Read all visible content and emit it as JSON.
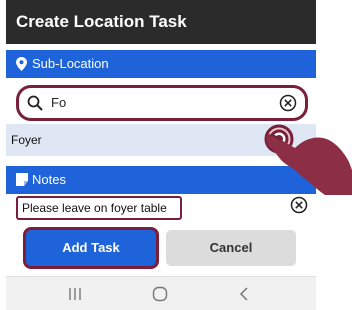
{
  "app": {
    "title": "Create Location Task"
  },
  "sub_location": {
    "header_label": "Sub-Location",
    "search_value": "Fo",
    "result_label": "Foyer"
  },
  "notes": {
    "header_label": "Notes",
    "value": "Please leave on foyer table"
  },
  "buttons": {
    "add_label": "Add Task",
    "cancel_label": "Cancel"
  },
  "icons": {
    "location": "map-pin-icon",
    "search": "search-icon",
    "clear": "clear-circle-x-icon",
    "notes": "note-icon",
    "nav_recent": "recent-apps-icon",
    "nav_home": "home-icon",
    "nav_back": "back-chevron-icon"
  },
  "colors": {
    "title_bar": "#2b2b2b",
    "section_header": "#1e63d9",
    "highlight_outline": "#7a1f3a",
    "selected_row": "#dfe7f4"
  }
}
